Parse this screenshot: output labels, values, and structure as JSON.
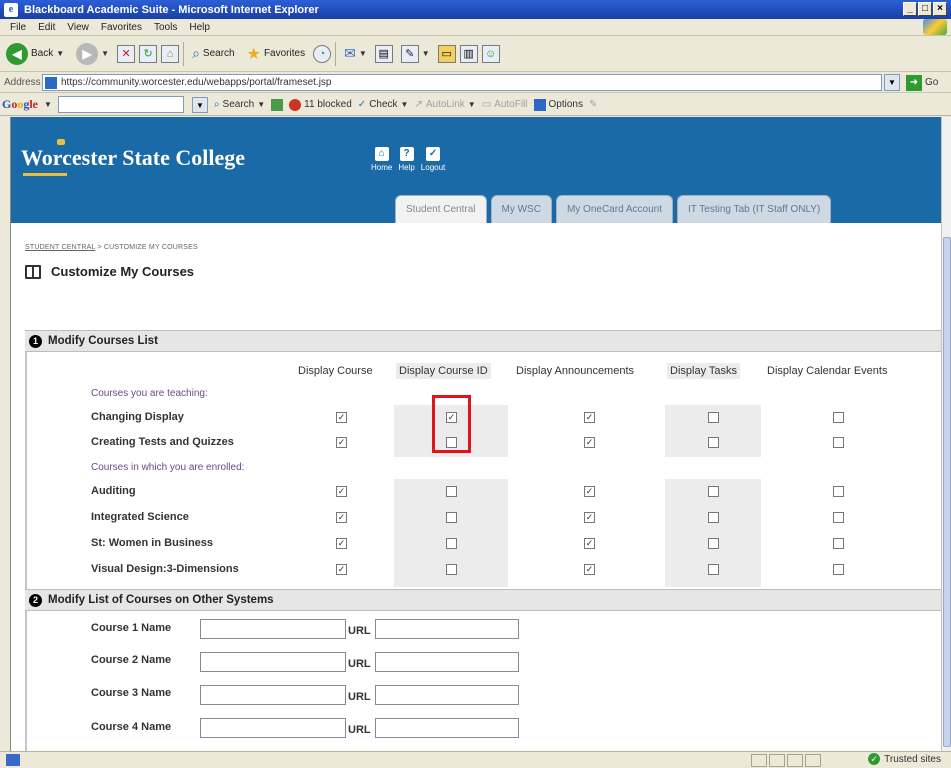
{
  "window": {
    "title": "Blackboard Academic Suite - Microsoft Internet Explorer"
  },
  "menu": [
    "File",
    "Edit",
    "View",
    "Favorites",
    "Tools",
    "Help"
  ],
  "toolbar": {
    "back": "Back",
    "search": "Search",
    "favorites": "Favorites"
  },
  "address": {
    "label": "Address",
    "url": "https://community.worcester.edu/webapps/portal/frameset.jsp",
    "go": "Go"
  },
  "google": {
    "search": "Search",
    "blocked": "11 blocked",
    "check": "Check",
    "autolink": "AutoLink",
    "autofill": "AutoFill",
    "options": "Options"
  },
  "site": {
    "brand": "Worcester State College",
    "nav": [
      {
        "label": "Home",
        "icon": "⌂"
      },
      {
        "label": "Help",
        "icon": "?"
      },
      {
        "label": "Logout",
        "icon": "✓"
      }
    ],
    "tabs": [
      "Student Central",
      "My WSC",
      "My OneCard Account",
      "IT Testing Tab (IT Staff ONLY)"
    ]
  },
  "breadcrumb": {
    "link": "STUDENT CENTRAL",
    "sep": " > ",
    "current": "CUSTOMIZE MY COURSES"
  },
  "page_title": "Customize My Courses",
  "section1": {
    "num": "1",
    "title": "Modify Courses List",
    "columns": [
      "Display Course",
      "Display Course ID",
      "Display Announcements",
      "Display Tasks",
      "Display Calendar Events"
    ],
    "teaching_label": "Courses you are teaching:",
    "enrolled_label": "Courses in which you are enrolled:",
    "teaching": [
      {
        "name": "Changing Display",
        "checks": [
          true,
          true,
          true,
          false,
          false
        ]
      },
      {
        "name": "Creating Tests and Quizzes",
        "checks": [
          true,
          false,
          true,
          false,
          false
        ]
      }
    ],
    "enrolled": [
      {
        "name": "Auditing",
        "checks": [
          true,
          false,
          true,
          false,
          false
        ]
      },
      {
        "name": "Integrated Science",
        "checks": [
          true,
          false,
          true,
          false,
          false
        ]
      },
      {
        "name": "St: Women in Business",
        "checks": [
          true,
          false,
          true,
          false,
          false
        ]
      },
      {
        "name": "Visual Design:3-Dimensions",
        "checks": [
          true,
          false,
          true,
          false,
          false
        ]
      }
    ]
  },
  "section2": {
    "num": "2",
    "title": "Modify List of Courses on Other Systems",
    "url_label": "URL",
    "rows": [
      "Course 1 Name",
      "Course 2 Name",
      "Course 3 Name",
      "Course 4 Name"
    ]
  },
  "status": {
    "zone": "Trusted sites"
  }
}
